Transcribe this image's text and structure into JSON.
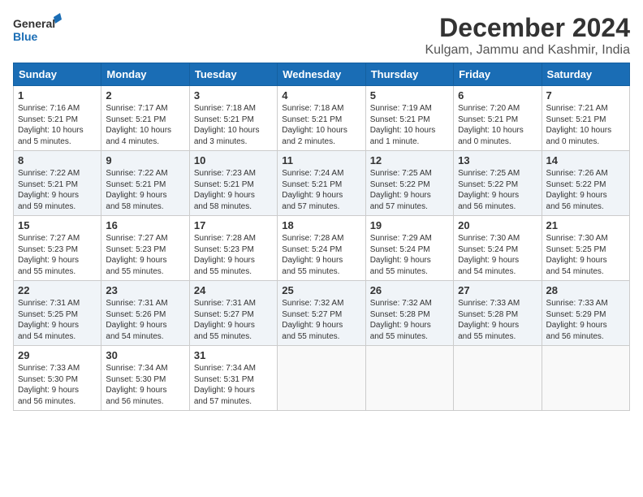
{
  "logo": {
    "line1": "General",
    "line2": "Blue"
  },
  "title": "December 2024",
  "subtitle": "Kulgam, Jammu and Kashmir, India",
  "weekdays": [
    "Sunday",
    "Monday",
    "Tuesday",
    "Wednesday",
    "Thursday",
    "Friday",
    "Saturday"
  ],
  "weeks": [
    [
      {
        "day": "1",
        "info": "Sunrise: 7:16 AM\nSunset: 5:21 PM\nDaylight: 10 hours\nand 5 minutes."
      },
      {
        "day": "2",
        "info": "Sunrise: 7:17 AM\nSunset: 5:21 PM\nDaylight: 10 hours\nand 4 minutes."
      },
      {
        "day": "3",
        "info": "Sunrise: 7:18 AM\nSunset: 5:21 PM\nDaylight: 10 hours\nand 3 minutes."
      },
      {
        "day": "4",
        "info": "Sunrise: 7:18 AM\nSunset: 5:21 PM\nDaylight: 10 hours\nand 2 minutes."
      },
      {
        "day": "5",
        "info": "Sunrise: 7:19 AM\nSunset: 5:21 PM\nDaylight: 10 hours\nand 1 minute."
      },
      {
        "day": "6",
        "info": "Sunrise: 7:20 AM\nSunset: 5:21 PM\nDaylight: 10 hours\nand 0 minutes."
      },
      {
        "day": "7",
        "info": "Sunrise: 7:21 AM\nSunset: 5:21 PM\nDaylight: 10 hours\nand 0 minutes."
      }
    ],
    [
      {
        "day": "8",
        "info": "Sunrise: 7:22 AM\nSunset: 5:21 PM\nDaylight: 9 hours\nand 59 minutes."
      },
      {
        "day": "9",
        "info": "Sunrise: 7:22 AM\nSunset: 5:21 PM\nDaylight: 9 hours\nand 58 minutes."
      },
      {
        "day": "10",
        "info": "Sunrise: 7:23 AM\nSunset: 5:21 PM\nDaylight: 9 hours\nand 58 minutes."
      },
      {
        "day": "11",
        "info": "Sunrise: 7:24 AM\nSunset: 5:21 PM\nDaylight: 9 hours\nand 57 minutes."
      },
      {
        "day": "12",
        "info": "Sunrise: 7:25 AM\nSunset: 5:22 PM\nDaylight: 9 hours\nand 57 minutes."
      },
      {
        "day": "13",
        "info": "Sunrise: 7:25 AM\nSunset: 5:22 PM\nDaylight: 9 hours\nand 56 minutes."
      },
      {
        "day": "14",
        "info": "Sunrise: 7:26 AM\nSunset: 5:22 PM\nDaylight: 9 hours\nand 56 minutes."
      }
    ],
    [
      {
        "day": "15",
        "info": "Sunrise: 7:27 AM\nSunset: 5:23 PM\nDaylight: 9 hours\nand 55 minutes."
      },
      {
        "day": "16",
        "info": "Sunrise: 7:27 AM\nSunset: 5:23 PM\nDaylight: 9 hours\nand 55 minutes."
      },
      {
        "day": "17",
        "info": "Sunrise: 7:28 AM\nSunset: 5:23 PM\nDaylight: 9 hours\nand 55 minutes."
      },
      {
        "day": "18",
        "info": "Sunrise: 7:28 AM\nSunset: 5:24 PM\nDaylight: 9 hours\nand 55 minutes."
      },
      {
        "day": "19",
        "info": "Sunrise: 7:29 AM\nSunset: 5:24 PM\nDaylight: 9 hours\nand 55 minutes."
      },
      {
        "day": "20",
        "info": "Sunrise: 7:30 AM\nSunset: 5:24 PM\nDaylight: 9 hours\nand 54 minutes."
      },
      {
        "day": "21",
        "info": "Sunrise: 7:30 AM\nSunset: 5:25 PM\nDaylight: 9 hours\nand 54 minutes."
      }
    ],
    [
      {
        "day": "22",
        "info": "Sunrise: 7:31 AM\nSunset: 5:25 PM\nDaylight: 9 hours\nand 54 minutes."
      },
      {
        "day": "23",
        "info": "Sunrise: 7:31 AM\nSunset: 5:26 PM\nDaylight: 9 hours\nand 54 minutes."
      },
      {
        "day": "24",
        "info": "Sunrise: 7:31 AM\nSunset: 5:27 PM\nDaylight: 9 hours\nand 55 minutes."
      },
      {
        "day": "25",
        "info": "Sunrise: 7:32 AM\nSunset: 5:27 PM\nDaylight: 9 hours\nand 55 minutes."
      },
      {
        "day": "26",
        "info": "Sunrise: 7:32 AM\nSunset: 5:28 PM\nDaylight: 9 hours\nand 55 minutes."
      },
      {
        "day": "27",
        "info": "Sunrise: 7:33 AM\nSunset: 5:28 PM\nDaylight: 9 hours\nand 55 minutes."
      },
      {
        "day": "28",
        "info": "Sunrise: 7:33 AM\nSunset: 5:29 PM\nDaylight: 9 hours\nand 56 minutes."
      }
    ],
    [
      {
        "day": "29",
        "info": "Sunrise: 7:33 AM\nSunset: 5:30 PM\nDaylight: 9 hours\nand 56 minutes."
      },
      {
        "day": "30",
        "info": "Sunrise: 7:34 AM\nSunset: 5:30 PM\nDaylight: 9 hours\nand 56 minutes."
      },
      {
        "day": "31",
        "info": "Sunrise: 7:34 AM\nSunset: 5:31 PM\nDaylight: 9 hours\nand 57 minutes."
      },
      null,
      null,
      null,
      null
    ]
  ]
}
